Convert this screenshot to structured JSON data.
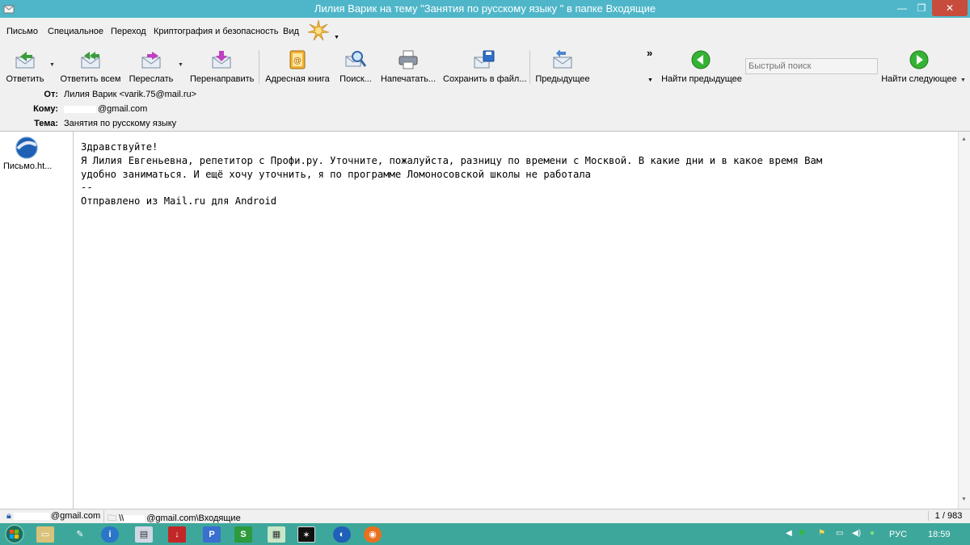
{
  "window": {
    "title": "Лилия  Варик на тему \"Занятия по русскому языку \" в папке Входящие",
    "min_glyph": "—",
    "max_glyph": "❐",
    "close_glyph": "✕"
  },
  "menu": [
    "Письмо",
    "Специальное",
    "Переход",
    "Криптография и безопасность",
    "Вид"
  ],
  "toolbar": {
    "reply": "Ответить",
    "reply_all": "Ответить всем",
    "forward": "Переслать",
    "redirect": "Перенаправить",
    "address_book": "Адресная книга",
    "search": "Поиск...",
    "print": "Напечатать...",
    "save": "Сохранить в файл...",
    "previous": "Предыдущее",
    "find_previous": "Найти предыдущее",
    "find_next": "Найти следующее",
    "more_glyph": "»",
    "search_placeholder": "Быстрый поиск"
  },
  "headers": {
    "from_label": "От:",
    "from_value": "Лилия  Варик <varik.75@mail.ru>",
    "to_label": "Кому:",
    "to_value": "@gmail.com",
    "subject_label": "Тема:",
    "subject_value": "Занятия по русскому языку"
  },
  "attachment": {
    "name": "Письмо.ht..."
  },
  "message": {
    "lines": [
      "Здравствуйте!",
      "Я Лилия Евгеньевна,  репетитор с Профи.ру. Уточните,  пожалуйста,  разницу по времени с Москвой.  В какие дни и в какое время Вам",
      "удобно заниматься. И ещё хочу уточнить, я по программе Ломоносовской  школы не работала",
      "--",
      "Отправлено из Mail.ru для Android"
    ]
  },
  "status": {
    "account": "@gmail.com",
    "folder_prefix": "\\\\",
    "folder": "@gmail.com\\Входящие",
    "count": "1 / 983"
  },
  "taskbar": {
    "lang": "РУС",
    "time": "18:59"
  },
  "colors": {
    "titlebar": "#4fb6c9",
    "close": "#c74c3c",
    "taskbar": "#3ea79b"
  }
}
